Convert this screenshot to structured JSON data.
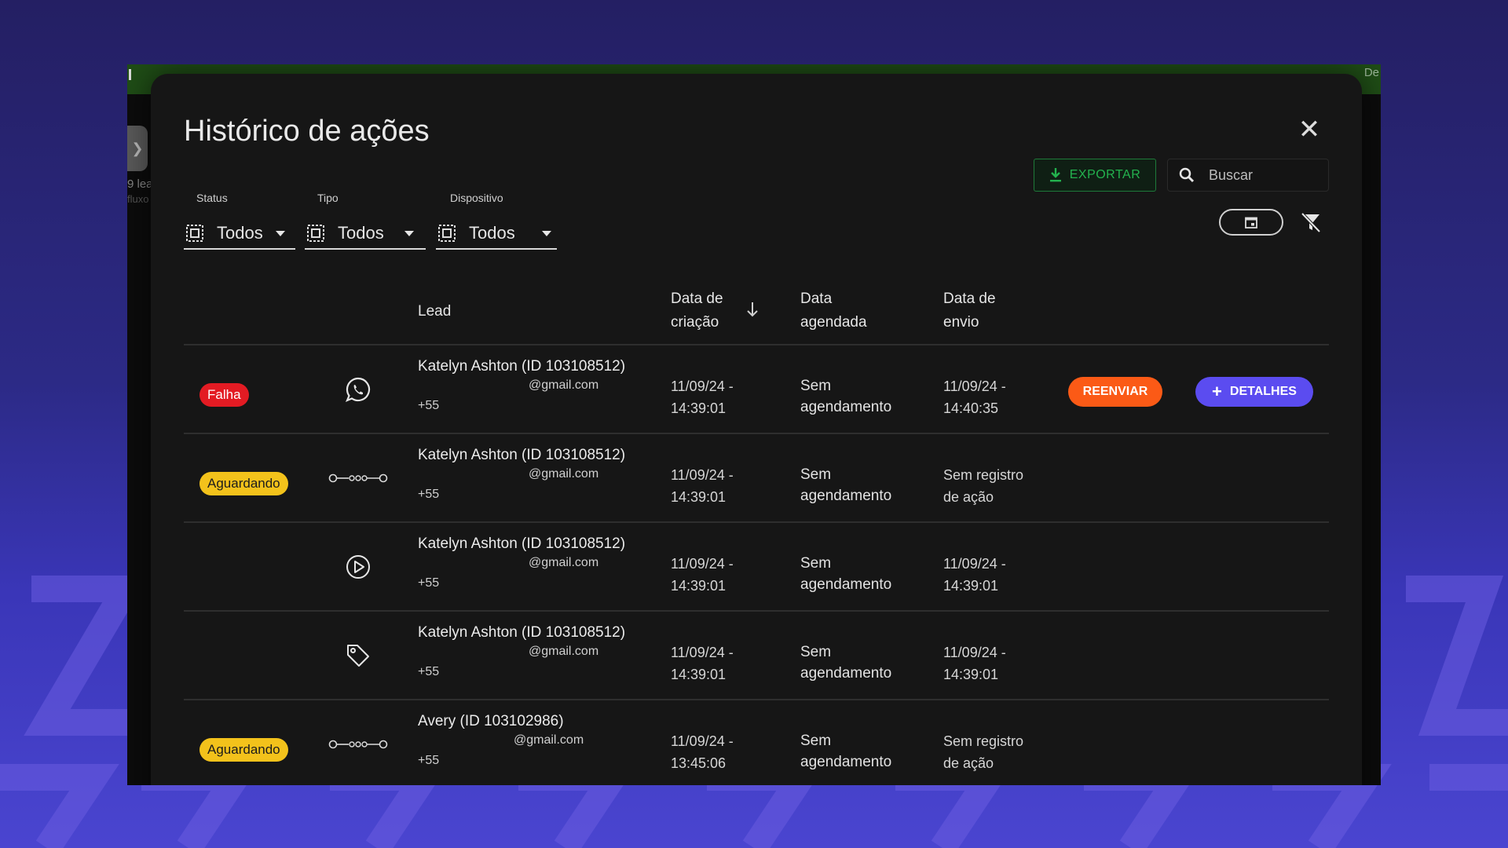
{
  "modal": {
    "title": "Histórico de ações",
    "export_label": "EXPORTAR",
    "search_placeholder": "Buscar"
  },
  "filters": [
    {
      "label": "Status",
      "value": "Todos"
    },
    {
      "label": "Tipo",
      "value": "Todos"
    },
    {
      "label": "Dispositivo",
      "value": "Todos"
    }
  ],
  "table": {
    "headers": {
      "lead": "Lead",
      "created_l1": "Data de",
      "created_l2": "criação",
      "scheduled_l1": "Data",
      "scheduled_l2": "agendada",
      "sent_l1": "Data de",
      "sent_l2": "envio"
    },
    "rows": [
      {
        "status": "Falha",
        "type_icon": "whatsapp-icon",
        "name": "Katelyn Ashton (ID 103108512)",
        "email": "@gmail.com",
        "phone": "+55",
        "created_l1": "11/09/24 -",
        "created_l2": "14:39:01",
        "scheduled_l1": "Sem",
        "scheduled_l2": "agendamento",
        "sent_l1": "11/09/24 -",
        "sent_l2": "14:40:35",
        "resend": "REENVIAR",
        "details": "DETALHES"
      },
      {
        "status": "Aguardando",
        "type_icon": "flow-icon",
        "name": "Katelyn Ashton (ID 103108512)",
        "email": "@gmail.com",
        "phone": "+55",
        "created_l1": "11/09/24 -",
        "created_l2": "14:39:01",
        "scheduled_l1": "Sem",
        "scheduled_l2": "agendamento",
        "sent_l1": "Sem registro",
        "sent_l2": "de ação"
      },
      {
        "status": "",
        "type_icon": "play-icon",
        "name": "Katelyn Ashton (ID 103108512)",
        "email": "@gmail.com",
        "phone": "+55",
        "created_l1": "11/09/24 -",
        "created_l2": "14:39:01",
        "scheduled_l1": "Sem",
        "scheduled_l2": "agendamento",
        "sent_l1": "11/09/24 -",
        "sent_l2": "14:39:01"
      },
      {
        "status": "",
        "type_icon": "tag-icon",
        "name": "Katelyn Ashton (ID 103108512)",
        "email": "@gmail.com",
        "phone": "+55",
        "created_l1": "11/09/24 -",
        "created_l2": "14:39:01",
        "scheduled_l1": "Sem",
        "scheduled_l2": "agendamento",
        "sent_l1": "11/09/24 -",
        "sent_l2": "14:39:01"
      },
      {
        "status": "Aguardando",
        "type_icon": "flow-icon",
        "name": "Avery (ID 103102986)",
        "email": "@gmail.com",
        "phone": "+55",
        "created_l1": "11/09/24 -",
        "created_l2": "13:45:06",
        "scheduled_l1": "Sem",
        "scheduled_l2": "agendamento",
        "sent_l1": "Sem registro",
        "sent_l2": "de ação"
      }
    ]
  },
  "background_app": {
    "top_right_text": "De",
    "side_text_1": "9 lea",
    "side_text_2": "fluxo"
  },
  "colors": {
    "failure_badge": "#e31b23",
    "waiting_badge": "#f3c21b",
    "export_green": "#23b24e",
    "resend_orange": "#fb5a16",
    "details_purple": "#5b4cf0"
  }
}
